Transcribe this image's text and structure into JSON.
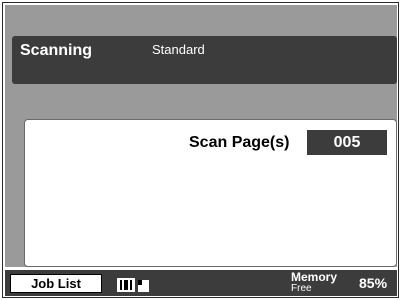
{
  "status": {
    "title": "Scanning",
    "mode": "Standard"
  },
  "scan": {
    "label": "Scan Page(s)",
    "value": "005"
  },
  "bottom": {
    "job_list_label": "Job List",
    "job_icons": "job-status-icons",
    "memory_label": "Memory",
    "memory_sub": "Free",
    "memory_percent": "85%"
  },
  "colors": {
    "background": "#9a9a9a",
    "dark": "#3c3c3c",
    "panel": "#ffffff"
  }
}
